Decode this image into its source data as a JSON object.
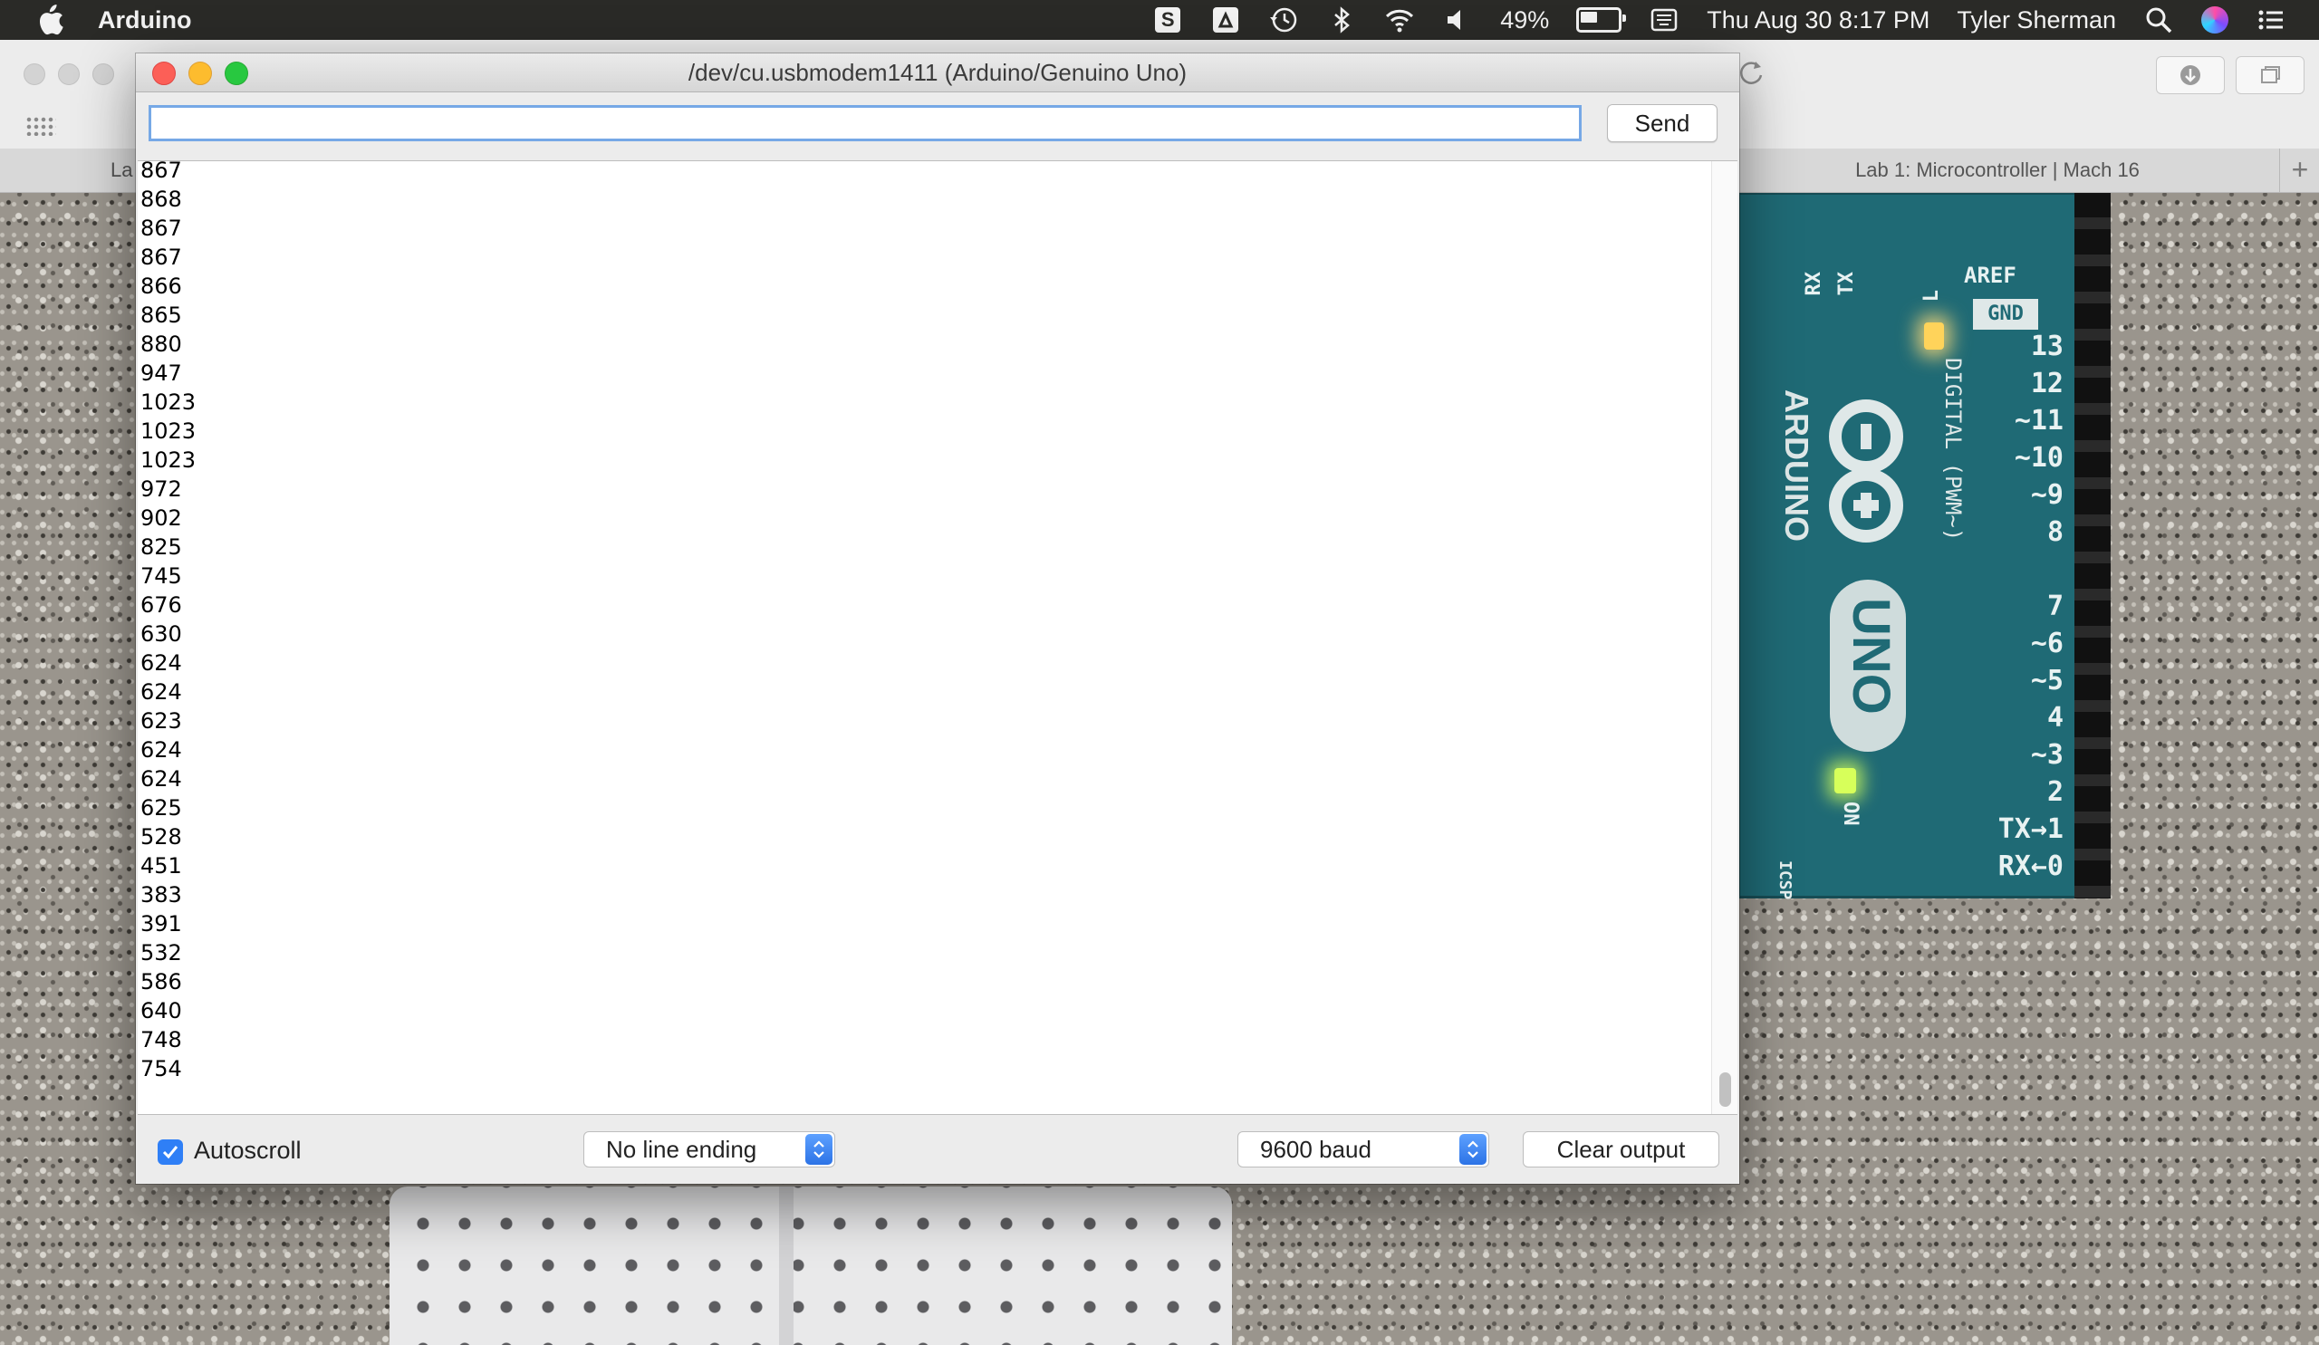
{
  "menubar": {
    "app_name": "Arduino",
    "battery_percent": "49%",
    "clock": "Thu Aug 30  8:17 PM",
    "user": "Tyler Sherman",
    "status_icons": [
      "s-icon",
      "drive-icon",
      "time-machine-icon",
      "bluetooth-icon",
      "wifi-icon",
      "volume-icon",
      "battery-icon",
      "keyboard-icon"
    ]
  },
  "browser": {
    "tab_left_text": "La",
    "tab_title": "Lab 1: Microcontroller | Mach 16"
  },
  "board": {
    "aref": "AREF",
    "gnd": "GND",
    "rx": "RX",
    "tx": "TX",
    "l": "L",
    "digital": "DIGITAL (PWM~)",
    "brand": "ARDUINO",
    "model": "UNO",
    "on": "ON",
    "icsp": "ICSP",
    "pins": [
      "13",
      "12",
      "~11",
      "~10",
      "~9",
      "8",
      "",
      "7",
      "~6",
      "~5",
      "4",
      "~3",
      "2",
      "TX→1",
      "RX←0"
    ]
  },
  "window": {
    "title": "/dev/cu.usbmodem1411 (Arduino/Genuino Uno)",
    "input_value": "",
    "send_label": "Send",
    "output_lines": [
      "867",
      "868",
      "867",
      "867",
      "866",
      "865",
      "880",
      "947",
      "1023",
      "1023",
      "1023",
      "972",
      "902",
      "825",
      "745",
      "676",
      "630",
      "624",
      "624",
      "623",
      "624",
      "624",
      "625",
      "528",
      "451",
      "383",
      "391",
      "532",
      "586",
      "640",
      "748",
      "754"
    ],
    "autoscroll_label": "Autoscroll",
    "autoscroll_checked": true,
    "line_ending": "No line ending",
    "baud": "9600 baud",
    "clear_label": "Clear output"
  }
}
